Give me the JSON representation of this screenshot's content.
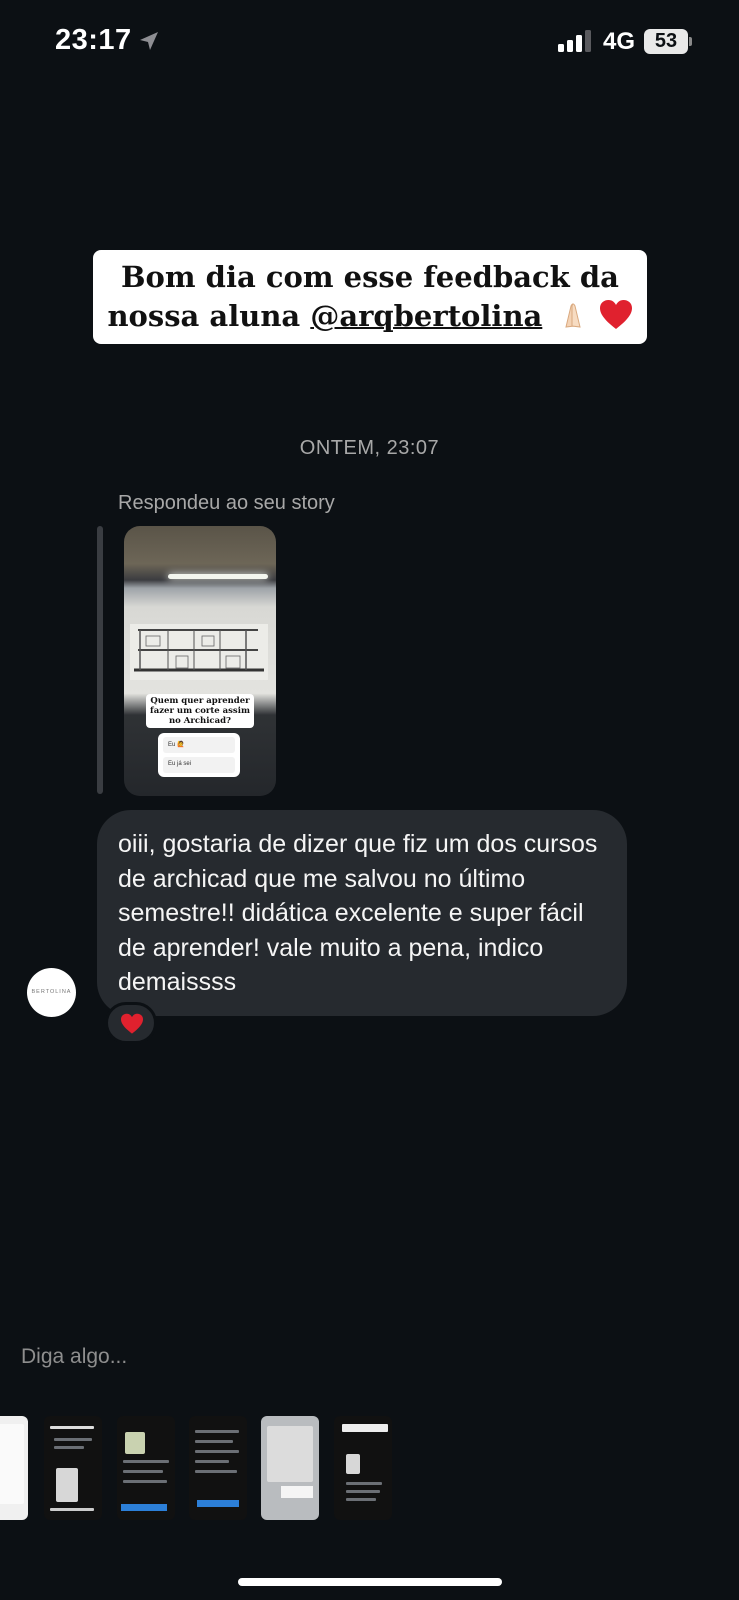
{
  "status_bar": {
    "time": "23:17",
    "network": "4G",
    "battery": "53"
  },
  "story_caption": {
    "line1": "Bom dia com esse feedback da",
    "line2_prefix": "nossa aluna ",
    "mention": "@arqbertolina",
    "emoji_icons": [
      "pray-icon",
      "heart-icon"
    ]
  },
  "conversation": {
    "date_separator": "ONTEM, 23:07",
    "reply_context": "Respondeu ao seu story",
    "story_preview": {
      "question": "Quem quer aprender fazer um corte assim no Archicad?",
      "poll_options": [
        "Eu 🙋",
        "Eu já sei"
      ]
    },
    "message": "oiii, gostaria de dizer que fiz um dos cursos de archicad que me salvou no último semestre!! didática excelente  e super fácil de aprender! vale muito a pena, indico demaissss",
    "avatar_text": "BERTOLINA",
    "reaction": "heart-icon"
  },
  "composer": {
    "placeholder": "Diga algo..."
  },
  "story_tray": {
    "count": 7
  },
  "colors": {
    "background": "#0c1014",
    "bubble": "#262a2f",
    "secondary_text": "#a8a8a8",
    "heart": "#e0212e"
  }
}
